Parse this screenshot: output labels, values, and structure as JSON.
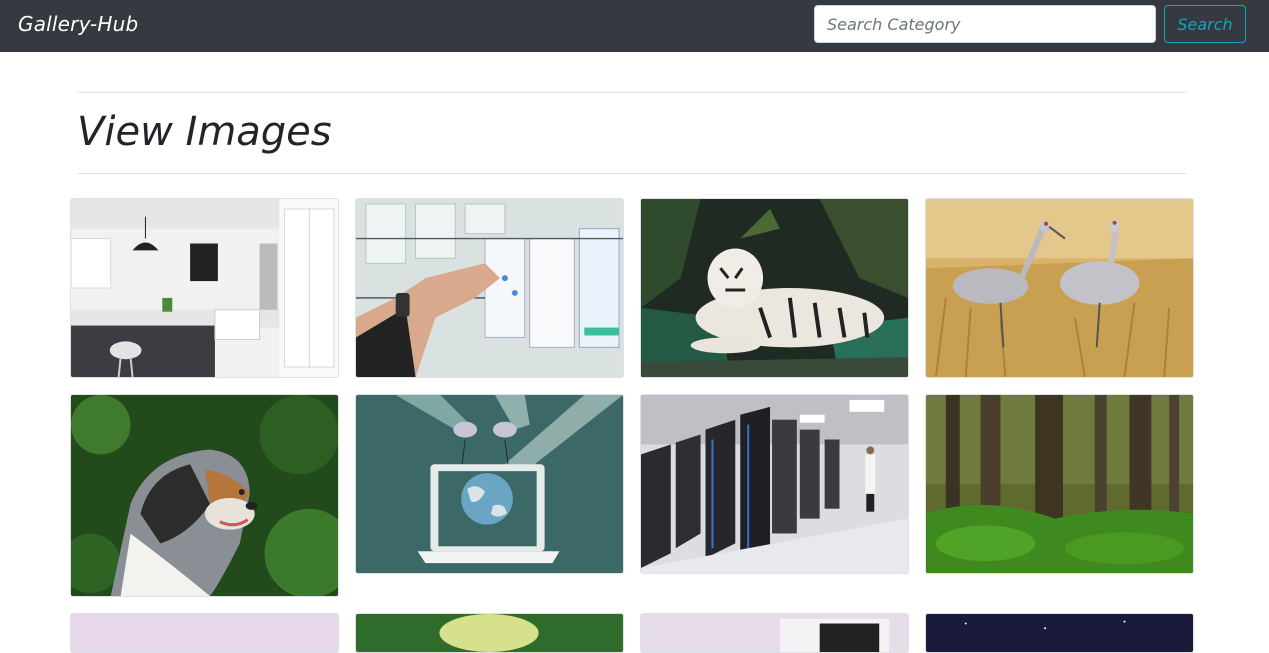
{
  "header": {
    "brand": "Gallery-Hub",
    "search": {
      "placeholder": "Search Category",
      "value": ""
    },
    "search_button_label": "Search"
  },
  "main": {
    "title": "View Images",
    "gallery": [
      {
        "subject": "kitchen interior"
      },
      {
        "subject": "hand pinning notes on whiteboard"
      },
      {
        "subject": "white tiger lying in jungle"
      },
      {
        "subject": "two cranes in dry grass"
      },
      {
        "subject": "australian shepherd dog among leaves"
      },
      {
        "subject": "laptop with globe illustration"
      },
      {
        "subject": "data center server racks"
      },
      {
        "subject": "green forest"
      },
      {
        "subject": "pale pink scene"
      },
      {
        "subject": "sunlit forest path"
      },
      {
        "subject": "office interior with monitor"
      },
      {
        "subject": "night sky stars"
      }
    ]
  },
  "colors": {
    "navbar": "#343a40",
    "accent": "#17a2b8",
    "text": "#212529"
  }
}
